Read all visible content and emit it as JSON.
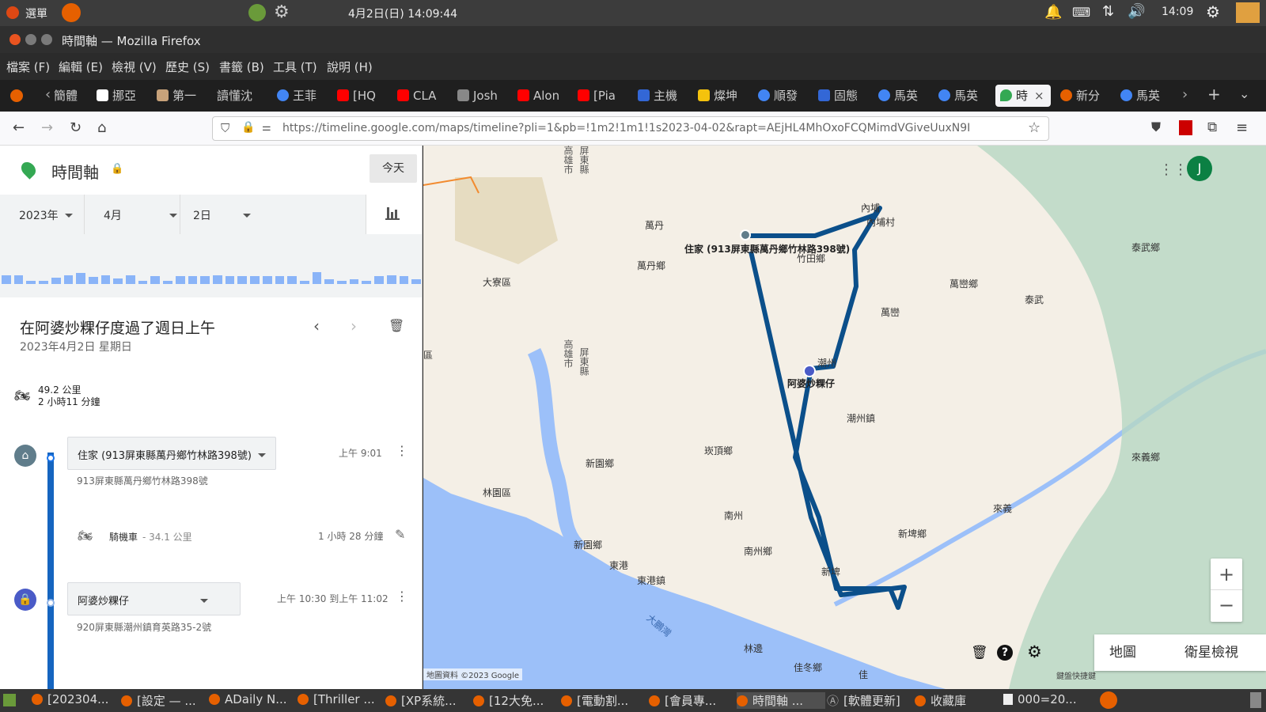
{
  "system": {
    "menu_label": "選單",
    "clock_center": "4月2日(日) 14:09:44",
    "clock_right": "14:09"
  },
  "window": {
    "title": "時間軸 — Mozilla Firefox"
  },
  "menubar": [
    "檔案 (F)",
    "編輯 (E)",
    "檢視 (V)",
    "歷史 (S)",
    "書籤 (B)",
    "工具 (T)",
    "說明 (H)"
  ],
  "tabs": [
    {
      "label": "簡體",
      "color": "#e66000"
    },
    {
      "label": "挪亞",
      "color": "#ffffff"
    },
    {
      "label": "第一",
      "color": "#c8a27a"
    },
    {
      "label": "讀懂沈",
      "color": "#666666"
    },
    {
      "label": "王菲",
      "color": "#4285f4"
    },
    {
      "label": "[HQ",
      "color": "#ff0000"
    },
    {
      "label": "CLA",
      "color": "#ff0000"
    },
    {
      "label": "Josh",
      "color": "#888888"
    },
    {
      "label": "Alon",
      "color": "#ff0000"
    },
    {
      "label": "[Pia",
      "color": "#ff0000"
    },
    {
      "label": "主機",
      "color": "#3367d6"
    },
    {
      "label": "燦坤",
      "color": "#f4c20d"
    },
    {
      "label": "順發",
      "color": "#4285f4"
    },
    {
      "label": "固態",
      "color": "#3367d6"
    },
    {
      "label": "馬英",
      "color": "#4285f4"
    },
    {
      "label": "馬英",
      "color": "#4285f4"
    },
    {
      "label": "時",
      "color": "#34a853"
    },
    {
      "label": "新分",
      "color": "#e66000"
    },
    {
      "label": "馬英",
      "color": "#4285f4"
    }
  ],
  "url": "https://timeline.google.com/maps/timeline?pli=1&pb=!1m2!1m1!1s2023-04-02&rapt=AEjHL4MhOxoFCQMimdVGiveUuxN9I",
  "timeline": {
    "title": "時間軸",
    "today_button": "今天",
    "year": "2023年",
    "month": "4月",
    "day": "2日",
    "day_title": "在阿婆炒粿仔度過了週日上午",
    "day_date": "2023年4月2日 星期日",
    "summary_distance": "49.2 公里",
    "summary_duration": "2 小時11 分鐘",
    "histogram": [
      0.55,
      0.55,
      0.2,
      0.2,
      0.4,
      0.55,
      0.7,
      0.45,
      0.55,
      0.35,
      0.55,
      0.2,
      0.5,
      0.2,
      0.5,
      0.5,
      0.5,
      0.55,
      0.5,
      0.5,
      0.5,
      0.5,
      0.5,
      0.5,
      0.2,
      0.75,
      0.3,
      0.2,
      0.3,
      0.2,
      0.5,
      0.55,
      0.5,
      0.3
    ],
    "segments": {
      "home_name": "住家 (913屏東縣萬丹鄉竹林路398號)",
      "home_address": "913屏東縣萬丹鄉竹林路398號",
      "home_time": "上午 9:01",
      "move_mode": "騎機車",
      "move_distance": "- 34.1 公里",
      "move_duration": "1 小時 28 分鐘",
      "place_name": "阿婆炒粿仔",
      "place_time": "上午 10:30 到上午 11:02",
      "place_address": "920屏東縣潮州鎮育英路35-2號"
    }
  },
  "map": {
    "labels": {
      "wandan": "萬丹",
      "wandan_xiang": "萬丹鄉",
      "daliao": "大寮區",
      "home_label": "住家 (913屏東縣萬丹鄉竹林路398號)",
      "zhutian": "竹田鄉",
      "neipu": "內埔",
      "neipu_village": "內埔村",
      "wanluan_xiang": "萬巒鄉",
      "wanluan": "萬巒",
      "taiwu_xiang": "泰武鄉",
      "taiwu": "泰武",
      "chaozhou": "潮州",
      "apo": "阿婆炒粿仔",
      "chaozhou_zhen": "潮州鎮",
      "kanding": "崁頂鄉",
      "xinyuan1": "新園鄉",
      "xinyuan2": "新園鄉",
      "linyuan": "林園區",
      "nanzhou": "南州",
      "nanzhou_xiang": "南州鄉",
      "donggang": "東港",
      "donggang_zhen": "東港鎮",
      "xinpi": "新埤鄉",
      "laiyi": "來義",
      "laiyi_xiang": "來義鄉",
      "linbian": "林邊",
      "jiadong": "佳冬鄉",
      "xinpi2": "新埤",
      "kaohsiung_city": "高雄市",
      "pingtung_county": "屏東縣",
      "dapeng": "大鵬灣",
      "qu": "區",
      "jia": "佳",
      "copyright": "地圖資料 ©2023 Google",
      "shortcut": "鍵盤快捷鍵"
    },
    "avatar_letter": "J",
    "map_button": "地圖",
    "satellite_button": "衛星檢視",
    "zoom_in": "+",
    "zoom_out": "−",
    "route_color": "#0b4f8a"
  },
  "taskbar": [
    "[202304...",
    "[設定 — ...",
    "ADaily N...",
    "[Thriller ...",
    "[XP系統...",
    "[12大免...",
    "[電動割...",
    "[會員專...",
    "時間軸 ...",
    "[軟體更新]",
    "收藏庫",
    "000=20..."
  ]
}
